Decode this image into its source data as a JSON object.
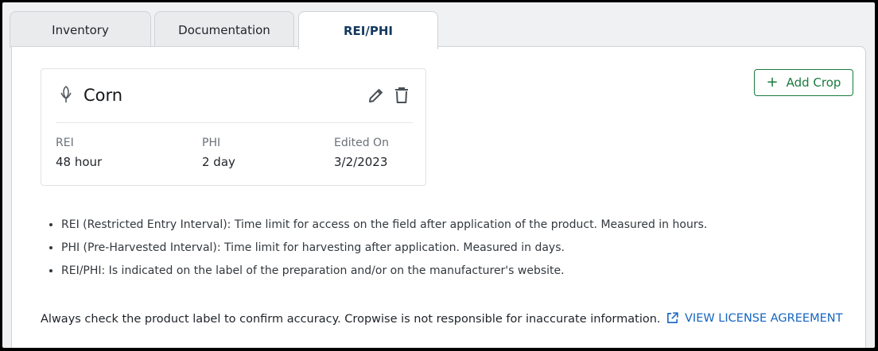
{
  "tabs": [
    {
      "label": "Inventory",
      "active": false
    },
    {
      "label": "Documentation",
      "active": false
    },
    {
      "label": "REI/PHI",
      "active": true
    }
  ],
  "card": {
    "crop_icon": "corn-icon",
    "crop_name": "Corn",
    "edit_icon": "pencil-icon",
    "delete_icon": "trash-icon",
    "columns": [
      {
        "label": "REI",
        "value": "48 hour"
      },
      {
        "label": "PHI",
        "value": "2 day"
      },
      {
        "label": "Edited On",
        "value": "3/2/2023"
      }
    ]
  },
  "add_crop": {
    "icon": "plus-icon",
    "label": "Add Crop"
  },
  "notes": [
    "REI (Restricted Entry Interval): Time limit for access on the field after application of the product. Measured in hours.",
    "PHI (Pre-Harvested Interval): Time limit for harvesting after application. Measured in days.",
    "REI/PHI: Is indicated on the label of the preparation and/or on the manufacturer's website."
  ],
  "disclaimer": "Always check the product label to confirm accuracy. Cropwise is not responsible for inaccurate information.",
  "license_link": {
    "icon": "external-link-icon",
    "label": "VIEW LICENSE AGREEMENT"
  },
  "colors": {
    "accent_green": "#1a7a3e",
    "link_blue": "#1565c0",
    "active_tab_text": "#14395e"
  }
}
